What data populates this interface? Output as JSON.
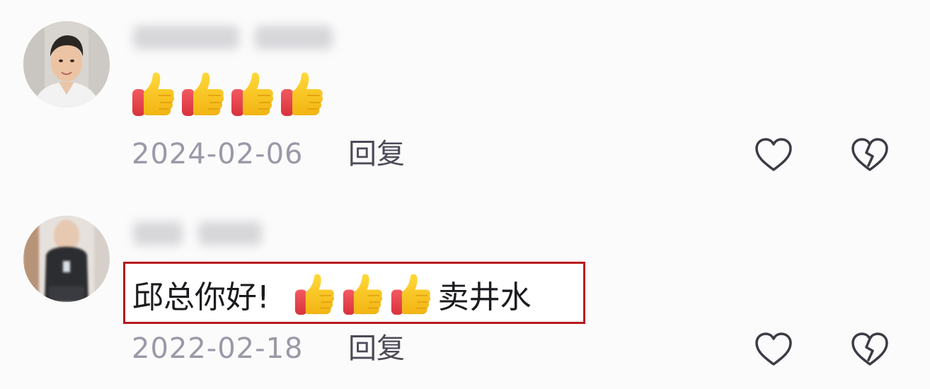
{
  "comments": [
    {
      "message_prefix": "",
      "emojis": [
        "thumbs-up",
        "thumbs-up",
        "thumbs-up",
        "thumbs-up"
      ],
      "message_suffix": "",
      "date": "2024-02-06",
      "reply_label": "回复"
    },
    {
      "message_prefix": "邱总你好!",
      "emojis": [
        "thumbs-up",
        "thumbs-up",
        "thumbs-up"
      ],
      "message_suffix": "卖井水",
      "date": "2022-02-18",
      "reply_label": "回复",
      "highlight_color": "#b8191e"
    }
  ],
  "icons": {
    "like": "heart-outline-icon",
    "dislike": "broken-heart-icon",
    "emoji": "thumbs-up-emoji"
  },
  "colors": {
    "date": "#9a99a8",
    "reply": "#4c4a58",
    "thumb_yellow": "#f5c423",
    "thumb_red": "#e9434d"
  }
}
